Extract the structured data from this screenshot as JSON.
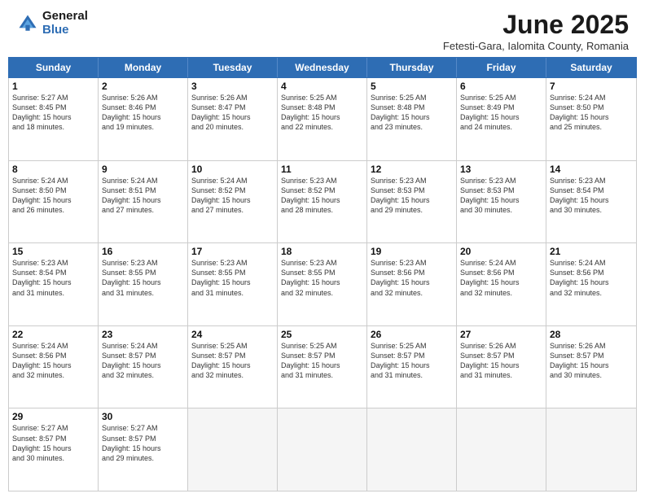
{
  "header": {
    "logo_general": "General",
    "logo_blue": "Blue",
    "month_title": "June 2025",
    "location": "Fetesti-Gara, Ialomita County, Romania"
  },
  "calendar": {
    "weekdays": [
      "Sunday",
      "Monday",
      "Tuesday",
      "Wednesday",
      "Thursday",
      "Friday",
      "Saturday"
    ],
    "rows": [
      [
        {
          "day": "1",
          "info": "Sunrise: 5:27 AM\nSunset: 8:45 PM\nDaylight: 15 hours\nand 18 minutes."
        },
        {
          "day": "2",
          "info": "Sunrise: 5:26 AM\nSunset: 8:46 PM\nDaylight: 15 hours\nand 19 minutes."
        },
        {
          "day": "3",
          "info": "Sunrise: 5:26 AM\nSunset: 8:47 PM\nDaylight: 15 hours\nand 20 minutes."
        },
        {
          "day": "4",
          "info": "Sunrise: 5:25 AM\nSunset: 8:48 PM\nDaylight: 15 hours\nand 22 minutes."
        },
        {
          "day": "5",
          "info": "Sunrise: 5:25 AM\nSunset: 8:48 PM\nDaylight: 15 hours\nand 23 minutes."
        },
        {
          "day": "6",
          "info": "Sunrise: 5:25 AM\nSunset: 8:49 PM\nDaylight: 15 hours\nand 24 minutes."
        },
        {
          "day": "7",
          "info": "Sunrise: 5:24 AM\nSunset: 8:50 PM\nDaylight: 15 hours\nand 25 minutes."
        }
      ],
      [
        {
          "day": "8",
          "info": "Sunrise: 5:24 AM\nSunset: 8:50 PM\nDaylight: 15 hours\nand 26 minutes."
        },
        {
          "day": "9",
          "info": "Sunrise: 5:24 AM\nSunset: 8:51 PM\nDaylight: 15 hours\nand 27 minutes."
        },
        {
          "day": "10",
          "info": "Sunrise: 5:24 AM\nSunset: 8:52 PM\nDaylight: 15 hours\nand 27 minutes."
        },
        {
          "day": "11",
          "info": "Sunrise: 5:23 AM\nSunset: 8:52 PM\nDaylight: 15 hours\nand 28 minutes."
        },
        {
          "day": "12",
          "info": "Sunrise: 5:23 AM\nSunset: 8:53 PM\nDaylight: 15 hours\nand 29 minutes."
        },
        {
          "day": "13",
          "info": "Sunrise: 5:23 AM\nSunset: 8:53 PM\nDaylight: 15 hours\nand 30 minutes."
        },
        {
          "day": "14",
          "info": "Sunrise: 5:23 AM\nSunset: 8:54 PM\nDaylight: 15 hours\nand 30 minutes."
        }
      ],
      [
        {
          "day": "15",
          "info": "Sunrise: 5:23 AM\nSunset: 8:54 PM\nDaylight: 15 hours\nand 31 minutes."
        },
        {
          "day": "16",
          "info": "Sunrise: 5:23 AM\nSunset: 8:55 PM\nDaylight: 15 hours\nand 31 minutes."
        },
        {
          "day": "17",
          "info": "Sunrise: 5:23 AM\nSunset: 8:55 PM\nDaylight: 15 hours\nand 31 minutes."
        },
        {
          "day": "18",
          "info": "Sunrise: 5:23 AM\nSunset: 8:55 PM\nDaylight: 15 hours\nand 32 minutes."
        },
        {
          "day": "19",
          "info": "Sunrise: 5:23 AM\nSunset: 8:56 PM\nDaylight: 15 hours\nand 32 minutes."
        },
        {
          "day": "20",
          "info": "Sunrise: 5:24 AM\nSunset: 8:56 PM\nDaylight: 15 hours\nand 32 minutes."
        },
        {
          "day": "21",
          "info": "Sunrise: 5:24 AM\nSunset: 8:56 PM\nDaylight: 15 hours\nand 32 minutes."
        }
      ],
      [
        {
          "day": "22",
          "info": "Sunrise: 5:24 AM\nSunset: 8:56 PM\nDaylight: 15 hours\nand 32 minutes."
        },
        {
          "day": "23",
          "info": "Sunrise: 5:24 AM\nSunset: 8:57 PM\nDaylight: 15 hours\nand 32 minutes."
        },
        {
          "day": "24",
          "info": "Sunrise: 5:25 AM\nSunset: 8:57 PM\nDaylight: 15 hours\nand 32 minutes."
        },
        {
          "day": "25",
          "info": "Sunrise: 5:25 AM\nSunset: 8:57 PM\nDaylight: 15 hours\nand 31 minutes."
        },
        {
          "day": "26",
          "info": "Sunrise: 5:25 AM\nSunset: 8:57 PM\nDaylight: 15 hours\nand 31 minutes."
        },
        {
          "day": "27",
          "info": "Sunrise: 5:26 AM\nSunset: 8:57 PM\nDaylight: 15 hours\nand 31 minutes."
        },
        {
          "day": "28",
          "info": "Sunrise: 5:26 AM\nSunset: 8:57 PM\nDaylight: 15 hours\nand 30 minutes."
        }
      ],
      [
        {
          "day": "29",
          "info": "Sunrise: 5:27 AM\nSunset: 8:57 PM\nDaylight: 15 hours\nand 30 minutes."
        },
        {
          "day": "30",
          "info": "Sunrise: 5:27 AM\nSunset: 8:57 PM\nDaylight: 15 hours\nand 29 minutes."
        },
        {
          "day": "",
          "info": ""
        },
        {
          "day": "",
          "info": ""
        },
        {
          "day": "",
          "info": ""
        },
        {
          "day": "",
          "info": ""
        },
        {
          "day": "",
          "info": ""
        }
      ]
    ]
  }
}
